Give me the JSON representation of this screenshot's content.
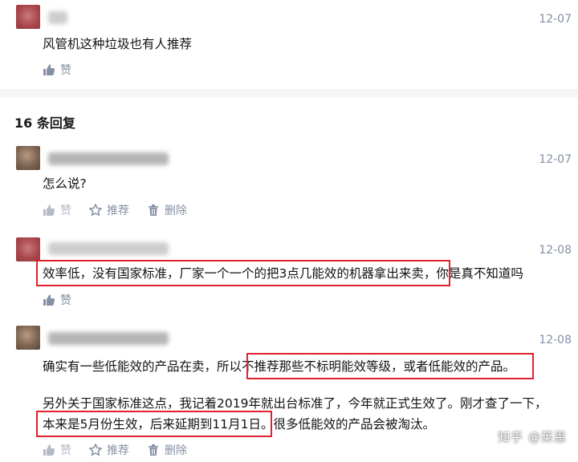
{
  "top_comment": {
    "date": "12-07",
    "text": "风管机这种垃圾也有人推荐",
    "like_label": "赞"
  },
  "replies_header": "16 条回复",
  "replies": [
    {
      "date": "12-07",
      "text": "怎么说?",
      "like_label": "赞",
      "recommend_label": "推荐",
      "delete_label": "删除"
    },
    {
      "date": "12-08",
      "text_highlighted": "效率低，没有国家标准，厂家一个一个的把3点几能效的机器拿出来卖，",
      "text_rest": "你是真不知道吗",
      "like_label": "赞"
    },
    {
      "date": "12-08",
      "line1_a": "确实有一些低能效的产品在卖，所以",
      "line1_b": "不推荐那些不标明能效等级，或者低能效的产品。",
      "line2": "另外关于国家标准这点，我记着2019年就出台标准了，今年就正式生效了。刚才查了一下，",
      "line3_a": "本来是5月份生效，后来延期到11月1日。",
      "line3_b": "很多低能效的产品会被淘汰。",
      "like_label": "赞",
      "recommend_label": "推荐",
      "delete_label": "删除"
    }
  ],
  "watermark": "知乎 @莱恩",
  "colors": {
    "meta_gray": "#8590a6",
    "highlight_red": "#e2202e"
  }
}
